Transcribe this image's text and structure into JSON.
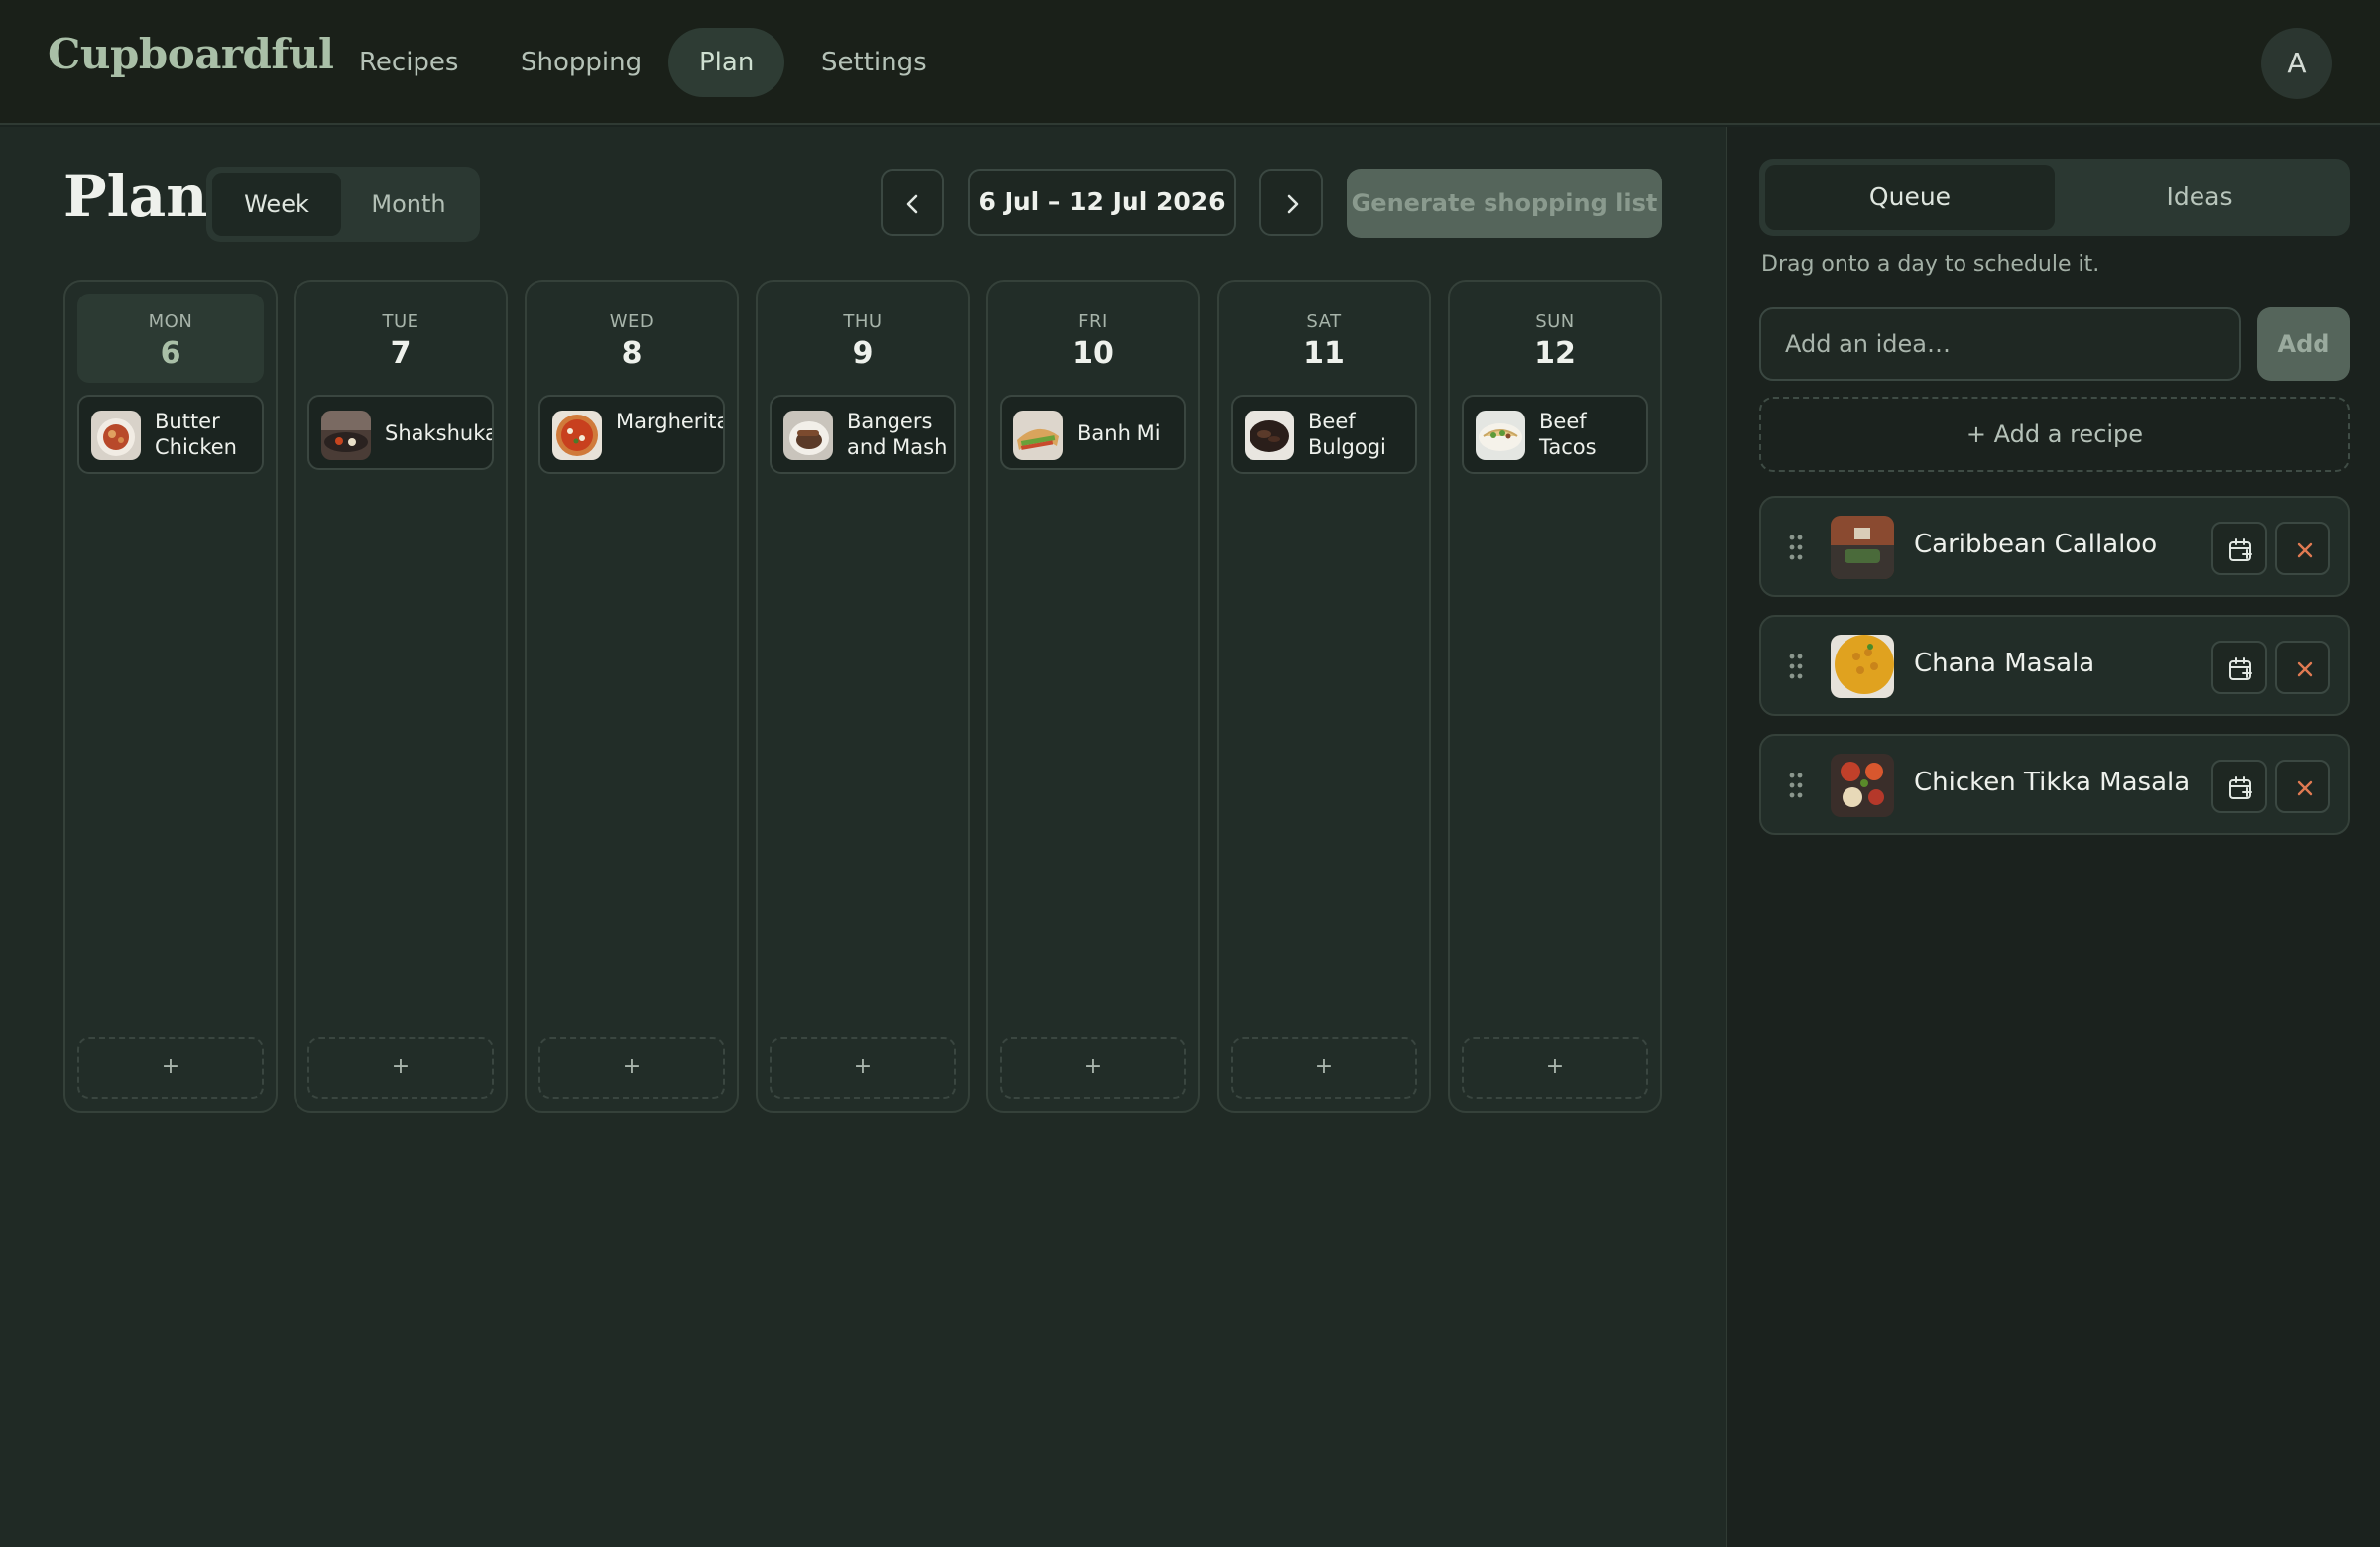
{
  "app": {
    "brand": "Cupboardful",
    "nav": [
      {
        "label": "Recipes"
      },
      {
        "label": "Shopping"
      },
      {
        "label": "Plan"
      },
      {
        "label": "Settings"
      }
    ],
    "active_nav": "Plan",
    "avatar_initial": "A"
  },
  "plan": {
    "title": "Plan",
    "view_options": [
      "Week",
      "Month"
    ],
    "active_view": "Week",
    "date_range": "6 Jul – 12 Jul 2026",
    "generate_label": "Generate shopping list",
    "add_slot_label": "+",
    "days": [
      {
        "dow": "MON",
        "num": "6",
        "today": true,
        "meal": "Butter Chicken",
        "thumb": "butter-chicken"
      },
      {
        "dow": "TUE",
        "num": "7",
        "today": false,
        "meal": "Shakshuka",
        "thumb": "shakshuka"
      },
      {
        "dow": "WED",
        "num": "8",
        "today": false,
        "meal": "Margherita Pizza",
        "thumb": "pizza"
      },
      {
        "dow": "THU",
        "num": "9",
        "today": false,
        "meal": "Bangers and Mash",
        "thumb": "bangers"
      },
      {
        "dow": "FRI",
        "num": "10",
        "today": false,
        "meal": "Banh Mi",
        "thumb": "banh-mi"
      },
      {
        "dow": "SAT",
        "num": "11",
        "today": false,
        "meal": "Beef Bulgogi",
        "thumb": "bulgogi"
      },
      {
        "dow": "SUN",
        "num": "12",
        "today": false,
        "meal": "Beef Tacos",
        "thumb": "tacos"
      }
    ]
  },
  "sidebar": {
    "tabs": [
      "Queue",
      "Ideas"
    ],
    "active_tab": "Queue",
    "hint": "Drag onto a day to schedule it.",
    "idea_placeholder": "Add an idea…",
    "idea_add_label": "Add",
    "add_recipe_label": "+ Add a recipe",
    "queue": [
      {
        "name": "Caribbean Callaloo",
        "thumb": "callaloo"
      },
      {
        "name": "Chana Masala",
        "thumb": "chana-masala"
      },
      {
        "name": "Chicken Tikka Masala",
        "thumb": "tikka-masala"
      }
    ]
  },
  "colors": {
    "background": "#202a25",
    "brand": "#a9bfa7",
    "accent_remove": "#e07a52",
    "muted_button": "#55655b"
  }
}
